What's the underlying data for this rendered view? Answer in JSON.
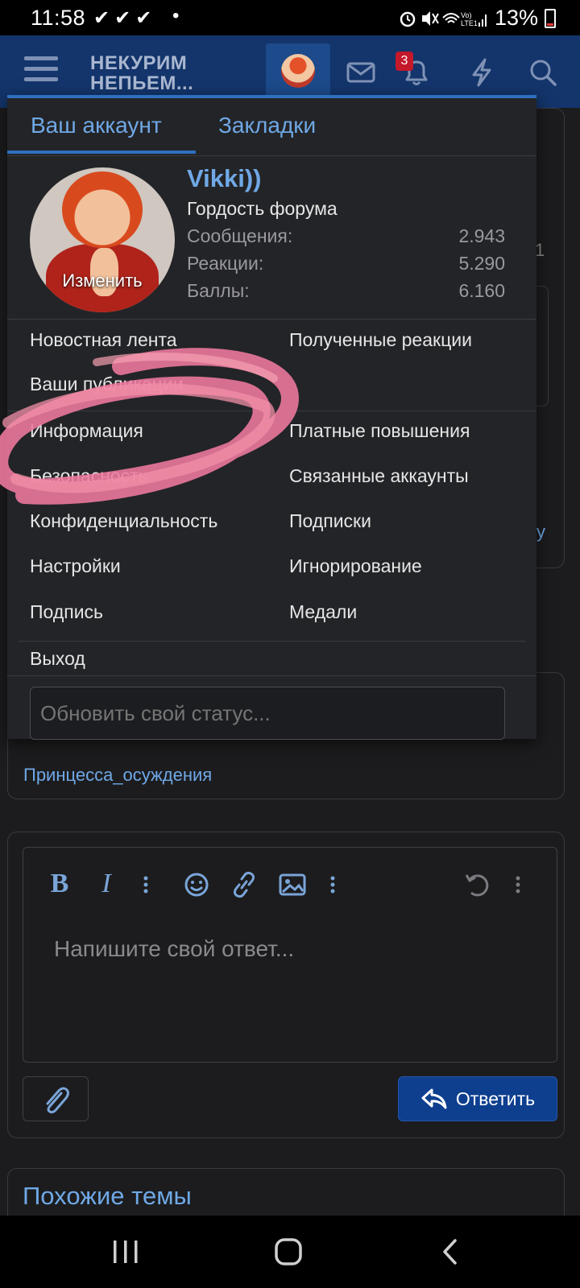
{
  "status_bar": {
    "time": "11:58",
    "notif_icons": "✔✔✔",
    "dot": "•",
    "battery": "13%"
  },
  "header": {
    "logo_line1": "НЕКУРИМ",
    "logo_line2": "НЕПЬЕМ...",
    "alerts_badge": "3"
  },
  "account_menu": {
    "tabs": [
      "Ваш аккаунт",
      "Закладки"
    ],
    "profile": {
      "username": "Vikki))",
      "user_title": "Гордость форума",
      "avatar_edit": "Изменить",
      "stats": [
        {
          "label": "Сообщения:",
          "value": "2.943"
        },
        {
          "label": "Реакции:",
          "value": "5.290"
        },
        {
          "label": "Баллы:",
          "value": "6.160"
        }
      ]
    },
    "items_top": {
      "left": [
        "Новостная лента",
        "Ваши публикации"
      ],
      "right": [
        "Полученные реакции"
      ]
    },
    "items_main": {
      "left": [
        "Информация",
        "Безопасность",
        "Конфиденциальность",
        "Настройки",
        "Подпись"
      ],
      "right": [
        "Платные повышения",
        "Связанные аккаунты",
        "Подписки",
        "Игнорирование",
        "Медали"
      ]
    },
    "logout": "Выход",
    "status_placeholder": "Обновить свой статус..."
  },
  "background": {
    "user_link": "Принцесса_осуждения",
    "peek_right_1": "1",
    "peek_right_2": "у"
  },
  "editor": {
    "placeholder": "Напишите свой ответ...",
    "reply_label": "Ответить"
  },
  "similar": {
    "title": "Похожие темы"
  }
}
